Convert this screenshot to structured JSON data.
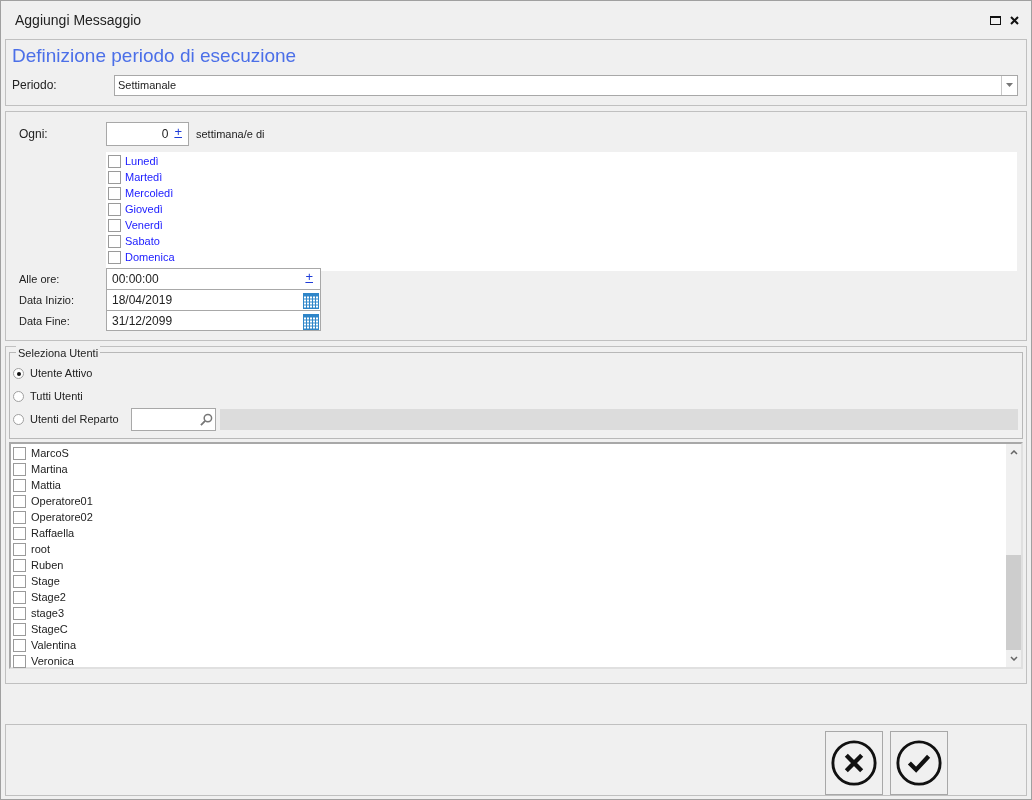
{
  "window": {
    "title": "Aggiungi Messaggio"
  },
  "header": {
    "title": "Definizione periodo di esecuzione",
    "period_label": "Periodo:",
    "period_value": "Settimanale"
  },
  "recurrence": {
    "every_label": "Ogni:",
    "every_value": "0",
    "every_spin": "+",
    "every_unit": "settimana/e di",
    "days": [
      {
        "label": "Lunedì",
        "checked": false
      },
      {
        "label": "Martedì",
        "checked": false
      },
      {
        "label": "Mercoledì",
        "checked": false
      },
      {
        "label": "Giovedì",
        "checked": false
      },
      {
        "label": "Venerdì",
        "checked": false
      },
      {
        "label": "Sabato",
        "checked": false
      },
      {
        "label": "Domenica",
        "checked": false
      }
    ],
    "time_label": "Alle ore:",
    "time_value": "00:00:00",
    "time_spin": "+",
    "start_label": "Data Inizio:",
    "start_value": "18/04/2019",
    "end_label": "Data Fine:",
    "end_value": "31/12/2099"
  },
  "users": {
    "group_title": "Seleziona Utenti",
    "options": [
      {
        "label": "Utente Attivo",
        "selected": true,
        "kind": "plain"
      },
      {
        "label": "Tutti Utenti",
        "selected": false,
        "kind": "plain"
      },
      {
        "label": "Utenti del Reparto",
        "selected": false,
        "kind": "search"
      }
    ],
    "list": [
      {
        "name": "MarcoS",
        "checked": false
      },
      {
        "name": "Martina",
        "checked": false
      },
      {
        "name": "Mattia",
        "checked": false
      },
      {
        "name": "Operatore01",
        "checked": false
      },
      {
        "name": "Operatore02",
        "checked": false
      },
      {
        "name": "Raffaella",
        "checked": false
      },
      {
        "name": "root",
        "checked": false
      },
      {
        "name": "Ruben",
        "checked": false
      },
      {
        "name": "Stage",
        "checked": false
      },
      {
        "name": "Stage2",
        "checked": false
      },
      {
        "name": "stage3",
        "checked": false
      },
      {
        "name": "StageC",
        "checked": false
      },
      {
        "name": "Valentina",
        "checked": false
      },
      {
        "name": "Veronica",
        "checked": false
      }
    ]
  },
  "buttons": [
    {
      "kind": "cancel"
    },
    {
      "kind": "confirm"
    }
  ]
}
